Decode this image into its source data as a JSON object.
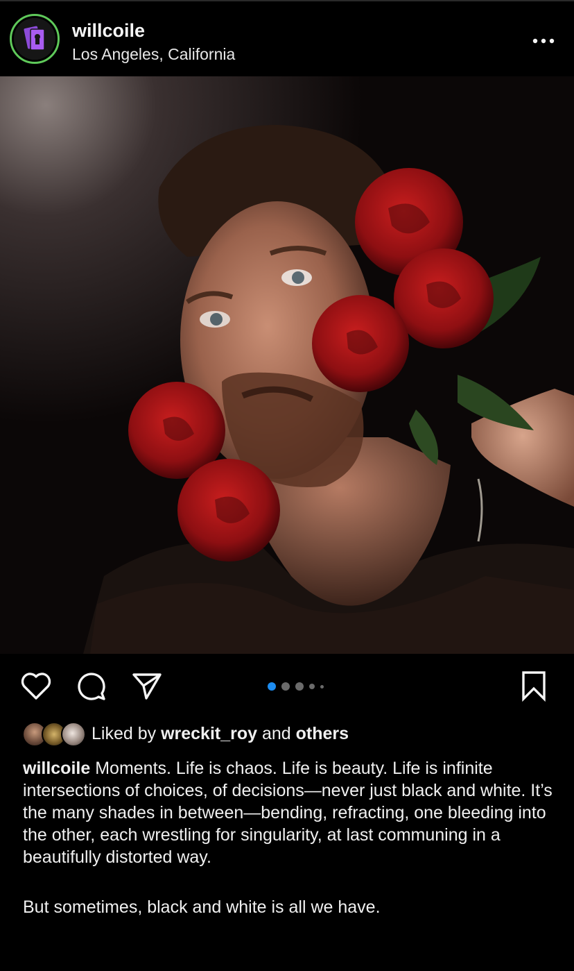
{
  "post": {
    "username": "willcoile",
    "location": "Los Angeles, California",
    "more_icon": "more-horizontal-icon",
    "ring_color": "#5fc95a"
  },
  "photo": {
    "subject": "man-with-red-roses-portrait"
  },
  "actions": {
    "like_icon": "heart-icon",
    "comment_icon": "comment-icon",
    "share_icon": "send-icon",
    "save_icon": "bookmark-icon",
    "carousel_count": 5,
    "carousel_active_index": 0,
    "active_dot_color": "#1d8cf0"
  },
  "likes": {
    "prefix": "Liked by ",
    "user": "wreckit_roy",
    "joiner": " and ",
    "others": "others"
  },
  "caption": {
    "username": "willcoile",
    "text": " Moments. Life is chaos. Life is beauty. Life is infinite intersections of choices, of decisions—never just black and white. It’s the many shades in between—bending, refracting, one bleeding into the other, each wrestling for singularity, at last communing in a beautifully distorted way.",
    "text2": "But sometimes, black and white is all we have."
  }
}
